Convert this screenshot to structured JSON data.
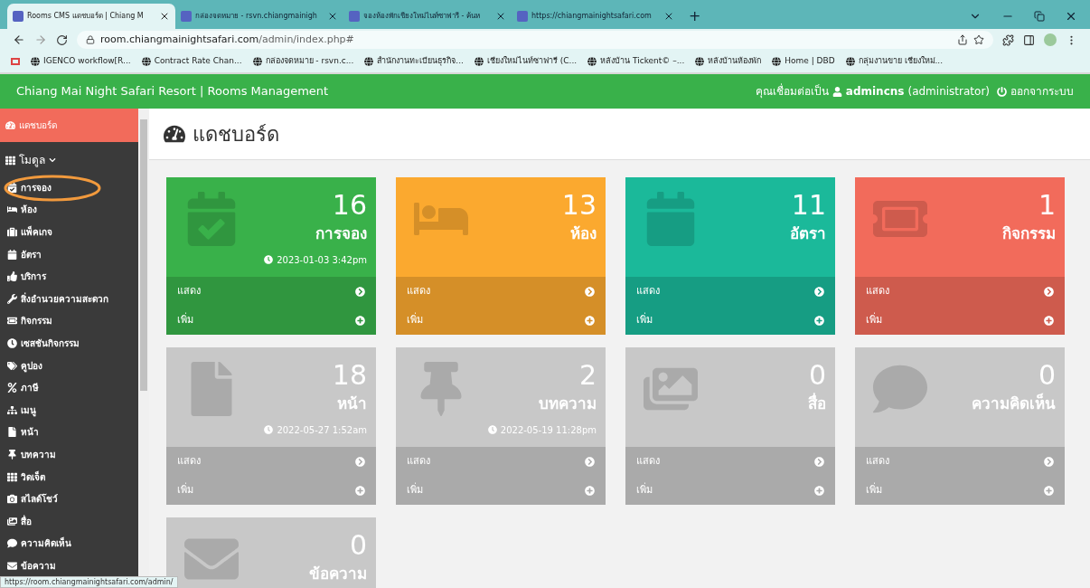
{
  "browser": {
    "tabs": [
      {
        "title": "Rooms CMS แดชบอร์ด | Chiang M",
        "selected": true
      },
      {
        "title": "กล่องจดหมาย - rsvn.chiangmainigh",
        "selected": false
      },
      {
        "title": "จองห้องพักเชียงใหม่ไนท์ซาฟารี - ค้นห",
        "selected": false
      },
      {
        "title": "https://chiangmainightsafari.com",
        "selected": false
      }
    ],
    "new_tab": "+",
    "url_host": "room.chiangmainightsafari.com",
    "url_path": "/admin/index.php#",
    "bookmarks": [
      "IGENCO workflow[R...",
      "Contract Rate Chan...",
      "กล่องจดหมาย - rsvn.c...",
      "สำนักงานทะเบียนธุรกิจ...",
      "เชียงใหม่ไนท์ซาฟารี (C...",
      "หลังบ้าน Tickent© –...",
      "หลังบ้านห้องพัก",
      "Home | DBD",
      "กลุ่มงานขาย เชียงใหม่..."
    ],
    "status_url": "https://room.chiangmainightsafari.com/admin/"
  },
  "header": {
    "title": "Chiang Mai Night Safari Resort | Rooms Management",
    "connected_as": "คุณเชื่อมต่อเป็น",
    "user": "admincns",
    "role": "(administrator)",
    "logout": "ออกจากระบบ"
  },
  "sidebar": {
    "dashboard": "แดชบอร์ด",
    "group": "โมดูล",
    "items": [
      "การจอง",
      "ห้อง",
      "แพ็คเกจ",
      "อัตรา",
      "บริการ",
      "สิ่งอำนวยความสะดวก",
      "กิจกรรม",
      "เซสชันกิจกรรม",
      "คูปอง",
      "ภาษี",
      "เมนู",
      "หน้า",
      "บทความ",
      "วิดเจ็ต",
      "สไลด์โชว์",
      "สื่อ",
      "ความคิดเห็น",
      "ข้อความ"
    ]
  },
  "page_title": "แดชบอร์ด",
  "cards": [
    {
      "count": "16",
      "label": "การจอง",
      "time": "2023-01-03 3:42pm",
      "color": "#39b14a",
      "links": [
        "แสดง",
        "เพิ่ม"
      ]
    },
    {
      "count": "13",
      "label": "ห้อง",
      "color": "#fba92f",
      "links": [
        "แสดง",
        "เพิ่ม"
      ]
    },
    {
      "count": "11",
      "label": "อัตรา",
      "color": "#1bb99a",
      "links": [
        "แสดง",
        "เพิ่ม"
      ]
    },
    {
      "count": "1",
      "label": "กิจกรรม",
      "color": "#f26b5b",
      "links": [
        "แสดง",
        "เพิ่ม"
      ]
    },
    {
      "count": "18",
      "label": "หน้า",
      "time": "2022-05-27 1:52am",
      "color": "#c8c8c8",
      "links": [
        "แสดง",
        "เพิ่ม"
      ]
    },
    {
      "count": "2",
      "label": "บทความ",
      "time": "2022-05-19 11:28pm",
      "color": "#c8c8c8",
      "links": [
        "แสดง",
        "เพิ่ม"
      ]
    },
    {
      "count": "0",
      "label": "สื่อ",
      "color": "#c8c8c8",
      "links": [
        "แสดง",
        "เพิ่ม"
      ]
    },
    {
      "count": "0",
      "label": "ความคิดเห็น",
      "color": "#c8c8c8",
      "links": [
        "แสดง",
        "เพิ่ม"
      ]
    },
    {
      "count": "0",
      "label": "ข้อความ",
      "color": "#c8c8c8"
    }
  ]
}
